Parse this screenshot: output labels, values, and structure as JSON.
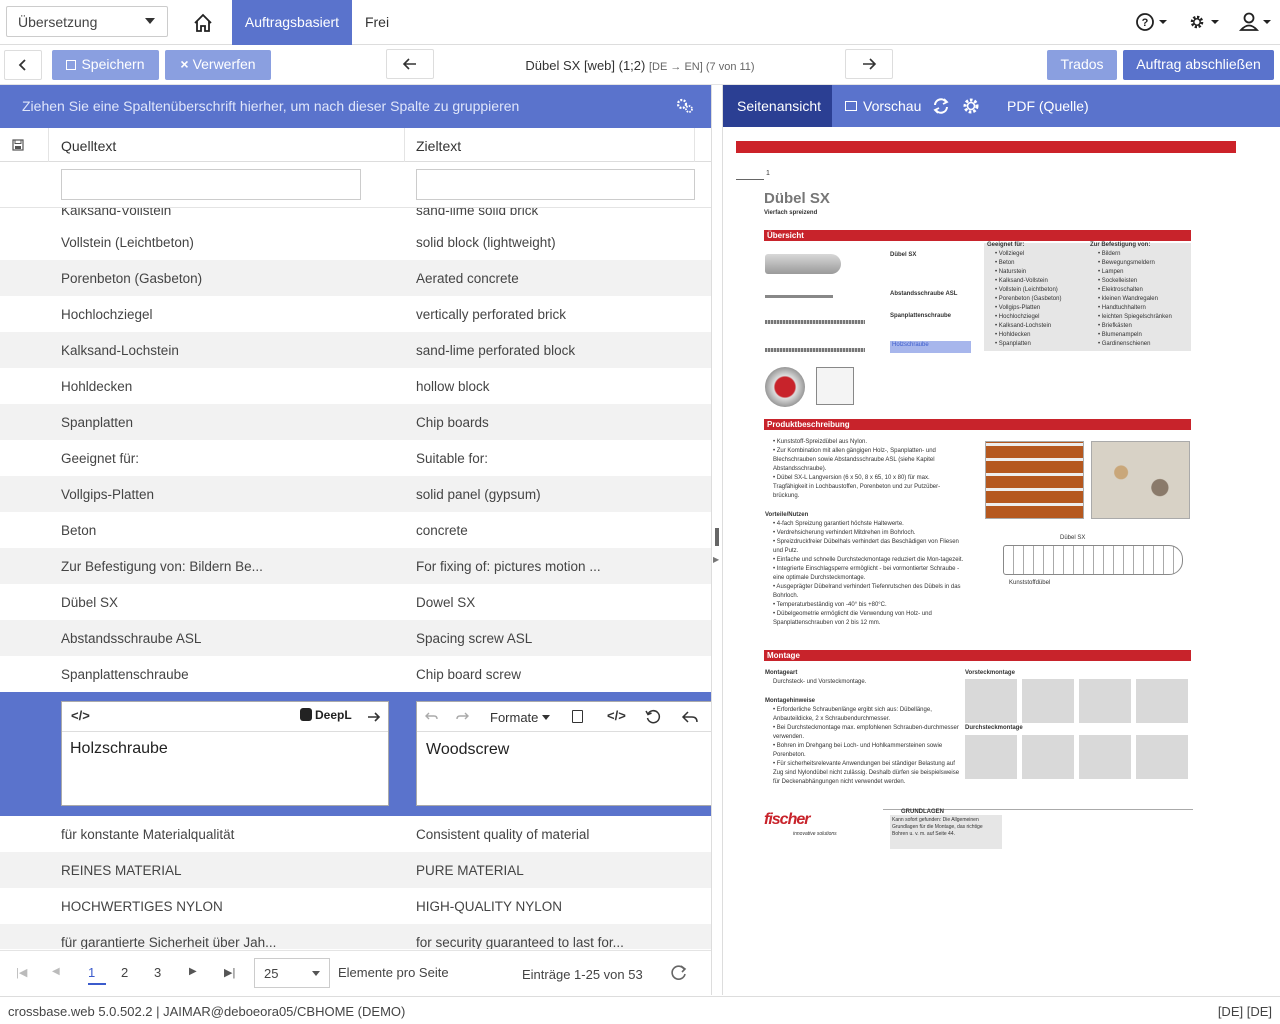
{
  "topnav": {
    "mode_select": "Übersetzung",
    "tabs": [
      {
        "label": "Auftragsbasiert",
        "active": true
      },
      {
        "label": "Frei",
        "active": false
      }
    ],
    "icons": [
      "home-icon",
      "help-icon",
      "gear-icon",
      "user-icon"
    ],
    "accent": "#5a73cc"
  },
  "toolbar": {
    "save_label": "Speichern",
    "discard_label": "Verwerfen",
    "doc_title": "Dübel SX [web] (1;2)",
    "lang_from": "DE",
    "lang_to": "EN",
    "position": "(7 von 11)",
    "trados_label": "Trados",
    "finish_label": "Auftrag abschließen"
  },
  "grid": {
    "group_hint": "Ziehen Sie eine Spaltenüberschrift hierher, um nach dieser Spalte zu gruppieren",
    "col_source": "Quelltext",
    "col_target": "Zieltext",
    "partial_top": {
      "src": "Kalksand-Vollstein",
      "tgt": "sand-lime solid brick"
    },
    "rows_before": [
      {
        "src": "Vollstein (Leichtbeton)",
        "tgt": "solid block (lightweight)"
      },
      {
        "src": "Porenbeton (Gasbeton)",
        "tgt": "Aerated concrete"
      },
      {
        "src": "Hochlochziegel",
        "tgt": "vertically perforated brick"
      },
      {
        "src": "Kalksand-Lochstein",
        "tgt": "sand-lime perforated block"
      },
      {
        "src": "Hohldecken",
        "tgt": "hollow block"
      },
      {
        "src": "Spanplatten",
        "tgt": "Chip boards"
      },
      {
        "src": "Geeignet für:",
        "tgt": "Suitable for:"
      },
      {
        "src": "Vollgips-Platten",
        "tgt": "solid panel (gypsum)"
      },
      {
        "src": "Beton",
        "tgt": "concrete"
      },
      {
        "src": "Zur Befestigung von: Bildern Be...",
        "tgt": "For fixing of: pictures motion ..."
      },
      {
        "src": "Dübel SX",
        "tgt": "Dowel SX"
      },
      {
        "src": "Abstandsschraube ASL",
        "tgt": "Spacing screw ASL"
      },
      {
        "src": "Spanplattenschraube",
        "tgt": "Chip board screw"
      }
    ],
    "editing": {
      "source": "Holzschraube",
      "target": "Woodscrew",
      "deepl_label": "DeepL",
      "formats_label": "Formate"
    },
    "rows_after": [
      {
        "src": "für konstante Materialqualität",
        "tgt": "Consistent quality of material"
      },
      {
        "src": "REINES MATERIAL",
        "tgt": "PURE MATERIAL"
      },
      {
        "src": "HOCHWERTIGES NYLON",
        "tgt": "HIGH-QUALITY NYLON"
      },
      {
        "src": "für garantierte Sicherheit über Jah...",
        "tgt": "for security guaranteed to last for..."
      }
    ]
  },
  "pager": {
    "pages": [
      "1",
      "2",
      "3"
    ],
    "current": "1",
    "page_size": "25",
    "page_size_label": "Elemente pro Seite",
    "entries": "Einträge 1-25 von 53"
  },
  "right_panel": {
    "tab_page": "Seitenansicht",
    "tab_preview": "Vorschau",
    "tab_pdf": "PDF (Quelle)"
  },
  "doc": {
    "page_no": "1",
    "title": "Dübel SX",
    "subtitle": "Vierfach spreizend",
    "sec_overview": "Übersicht",
    "sec_product": "Produktbeschreibung",
    "sec_montage": "Montage",
    "parts": [
      "Dübel SX",
      "Abstandsschraube ASL",
      "Spanplattenschraube",
      "Holzschraube"
    ],
    "suitable_head": "Geeignet für:",
    "suitable": [
      "Vollziegel",
      "Beton",
      "Naturstein",
      "Kalksand-Vollstein",
      "Vollstein (Leichtbeton)",
      "Porenbeton (Gasbeton)",
      "Vollgips-Platten",
      "Hochlochziegel",
      "Kalksand-Lochstein",
      "Hohldecken",
      "Spanplatten"
    ],
    "fix_head": "Zur Befestigung von:",
    "fix": [
      "Bildern",
      "Bewegungsmeldern",
      "Lampen",
      "Sockelleisten",
      "Elektroschalten",
      "kleinen Wandregalen",
      "Handtuchhaltern",
      "leichten Spiegelschränken",
      "Briefkästen",
      "Blumenampeln",
      "Gardinenschienen"
    ],
    "product": [
      "Kunststoff-Spreizdübel aus Nylon.",
      "Zur Kombination mit allen gängigen Holz-, Spanplatten- und Blechschrauben sowie Abstandsschraube ASL (siehe Kapitel Abstandsschraube).",
      "Dübel SX-L Langversion (6 x 50, 8 x 65, 10 x 80) für max. Tragfähigkeit in Lochbaustoffen, Porenbeton und zur Putzüber-brückung."
    ],
    "benefits_head": "Vorteile/Nutzen",
    "benefits": [
      "4-fach Spreizung garantiert höchste Haltewerte.",
      "Verdrehsicherung verhindert Mitdrehen im Bohrloch.",
      "Spreizdruckfreier Dübelhals verhindert das Beschädigen von Fliesen und Putz.",
      "Einfache und schnelle Durchsteckmontage reduziert die Mon-tagezeit.",
      "Integrierte Einschlagsperre ermöglicht - bei vormontierter Schraube - eine optimale Durchsteckmontage.",
      "Ausgeprägter Dübelrand verhindert Tiefenrutschen des Dübels in das Bohrloch.",
      "Temperaturbeständig von -40° bis +80°C.",
      "Dübelgeometrie ermöglicht die Verwendung von Holz- und Spanplattenschrauben von 2 bis 12 mm."
    ],
    "diagram_label": "Dübel SX",
    "diagram_sub": "Kunststoffdübel",
    "montageart_head": "Montageart",
    "montageart": "Durchsteck- und Vorsteckmontage.",
    "hints_head": "Montagehinweise",
    "hints": [
      "Erforderliche Schraubenlänge ergibt sich aus: Dübellänge, Anbauteildicke, 2 x Schraubendurchmesser.",
      "Bei Durchsteckmontage max. empfohlenen Schrauben-durchmesser verwenden.",
      "Bohren im Drehgang bei Loch- und Hohlkammersteinen sowie Porenbeton.",
      "Für sicherheitsrelevante Anwendungen bei ständiger Belastung auf Zug sind Nylondübel nicht zulässig. Deshalb dürfen sie beispielsweise für Deckenabhängungen nicht verwendet werden."
    ],
    "vorsteck": "Vorsteckmontage",
    "durchsteck": "Durchsteckmontage",
    "brand": "fischer",
    "brand_tag": "innovative solutions",
    "grundlagen": "GRUNDLAGEN",
    "grundlagen_text": "Kann sofort gefunden: Die Allgemeinen Grundlagen für die Montage, das richtige Bohren u. v. m. auf Seite 44."
  },
  "statusbar": {
    "left": "crossbase.web 5.0.502.2 | JAIMAR@deboeora05/CBHOME (DEMO)",
    "right": "[DE] [DE]"
  }
}
